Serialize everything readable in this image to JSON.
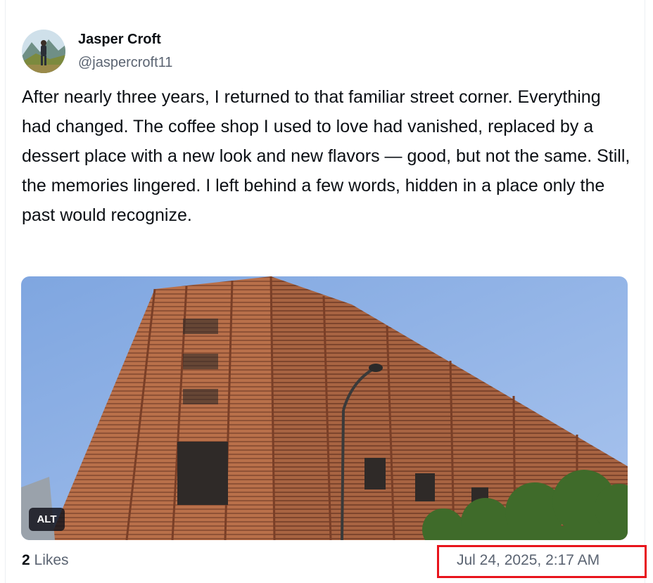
{
  "post": {
    "author": {
      "display_name": "Jasper Croft",
      "handle": "@jaspercroft11",
      "avatar_icon": "avatar-hiker-mountains"
    },
    "text": "After nearly three years, I returned to that familiar street corner. Everything had changed. The coffee shop I used to love had vanished, replaced by a dessert place with a new look and new flavors — good, but not the same. Still, the memories lingered. I left behind a few words, hidden in a place only the past would recognize.",
    "media": {
      "alt_label": "ALT"
    },
    "footer": {
      "likes_count": "2",
      "likes_label": "Likes",
      "timestamp": "Jul 24, 2025, 2:17 AM"
    }
  },
  "colors": {
    "text_primary": "#0b0f14",
    "text_secondary": "#5b6472",
    "highlight_border": "#e8141c"
  }
}
